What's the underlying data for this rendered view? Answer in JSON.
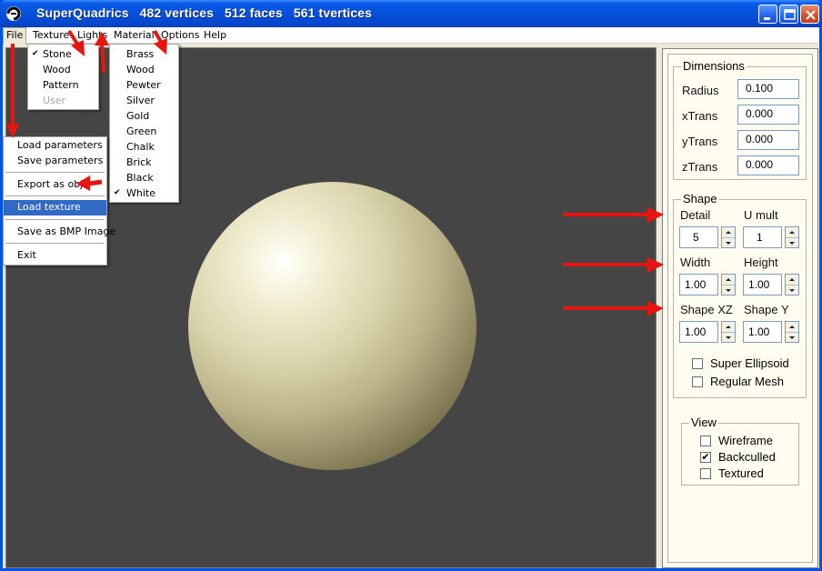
{
  "window": {
    "title": "SuperQuadrics   482 vertices   512 faces   561 tvertices"
  },
  "menubar": {
    "items": [
      "File",
      "Texture",
      "Lights",
      "Material",
      "Options",
      "Help"
    ]
  },
  "texture_menu": {
    "items": [
      {
        "label": "Stone",
        "checked": true,
        "enabled": true
      },
      {
        "label": "Wood",
        "checked": false,
        "enabled": true
      },
      {
        "label": "Pattern",
        "checked": false,
        "enabled": true
      },
      {
        "label": "User",
        "checked": false,
        "enabled": false
      }
    ]
  },
  "material_menu": {
    "items": [
      "Brass",
      "Wood",
      "Pewter",
      "Silver",
      "Gold",
      "Green",
      "Chalk",
      "Brick",
      "Black",
      "White"
    ],
    "checked": "White"
  },
  "file_menu": {
    "items": [
      "Load parameters",
      "Save parameters",
      "Export as obj",
      "Load texture",
      "Save as BMP Image",
      "Exit"
    ],
    "highlighted": "Load texture"
  },
  "dimensions": {
    "title": "Dimensions",
    "fields": [
      {
        "label": "Radius",
        "value": "0.100"
      },
      {
        "label": "xTrans",
        "value": "0.000"
      },
      {
        "label": "yTrans",
        "value": "0.000"
      },
      {
        "label": "zTrans",
        "value": "0.000"
      }
    ]
  },
  "shape": {
    "title": "Shape",
    "detail_label": "Detail",
    "detail_value": "5",
    "umult_label": "U mult",
    "umult_value": "1",
    "width_label": "Width",
    "width_value": "1.00",
    "height_label": "Height",
    "height_value": "1.00",
    "shapexz_label": "Shape XZ",
    "shapexz_value": "1.00",
    "shapey_label": "Shape Y",
    "shapey_value": "1.00",
    "super_ellipsoid_label": "Super Ellipsoid",
    "super_ellipsoid_checked": false,
    "regular_mesh_label": "Regular Mesh",
    "regular_mesh_checked": false
  },
  "view": {
    "title": "View",
    "wireframe_label": "Wireframe",
    "wireframe_checked": false,
    "backculled_label": "Backculled",
    "backculled_checked": true,
    "textured_label": "Textured",
    "textured_checked": false
  },
  "colors": {
    "annotation_arrow": "#e8140f",
    "viewport_bg": "#454545",
    "highlight": "#316ac5"
  }
}
